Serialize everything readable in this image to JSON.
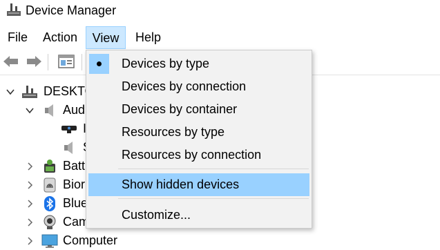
{
  "window": {
    "title": "Device Manager",
    "app_icon": "device-manager-icon"
  },
  "menubar": {
    "file": "File",
    "action": "Action",
    "view": "View",
    "help": "Help"
  },
  "toolbar": {
    "icons": [
      "back-arrow-icon",
      "forward-arrow-icon",
      "properties-icon"
    ]
  },
  "tree": {
    "root": "DESKTO",
    "audio": "Aud",
    "audio_child1": "I",
    "audio_child2": "S",
    "battery": "Batt",
    "biometric": "Bior",
    "bluetooth": "Blue",
    "camera": "Cam",
    "computer": "Computer"
  },
  "view_menu": {
    "items": [
      {
        "label": "Devices by type",
        "checked": true
      },
      {
        "label": "Devices by connection"
      },
      {
        "label": "Devices by container"
      },
      {
        "label": "Resources by type"
      },
      {
        "label": "Resources by connection"
      },
      {
        "label": "Show hidden devices",
        "highlighted": true
      },
      {
        "label": "Customize..."
      }
    ]
  },
  "colors": {
    "highlight": "#99d1ff",
    "menu_open_bg": "#cce8ff",
    "menu_bg": "#f2f2f2"
  }
}
